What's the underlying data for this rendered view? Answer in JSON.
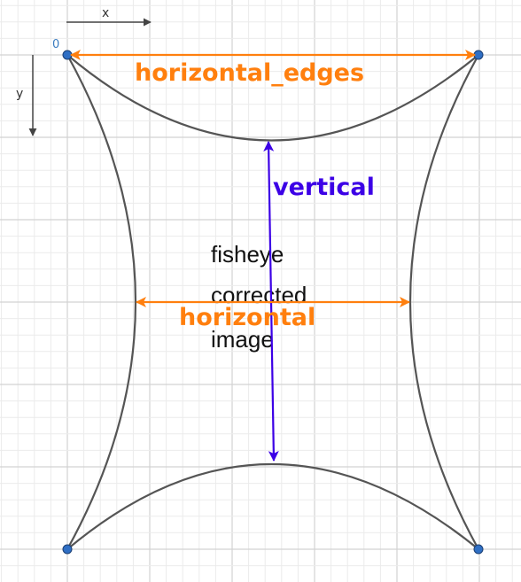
{
  "axes": {
    "x_label": "x",
    "y_label": "y",
    "origin_label": "0"
  },
  "labels": {
    "horizontal_edges": "horizontal_edges",
    "vertical": "vertical",
    "horizontal": "horizontal",
    "center_lines": [
      "fisheye",
      "corrected",
      "image"
    ]
  },
  "colors": {
    "orange": "#ff7f0e",
    "blue": "#3c00e6",
    "curve": "#555555",
    "point_fill": "#2f6fc4",
    "grid_minor": "#ebebeb",
    "grid_major": "#d2d2d2"
  }
}
